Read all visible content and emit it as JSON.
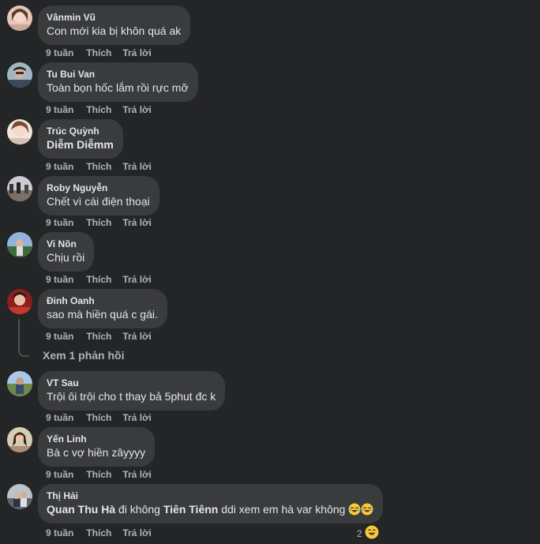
{
  "comments": [
    {
      "author": "Vânmin Vũ",
      "text": "Con mới kia bị khôn quá ak",
      "time": "9 tuần",
      "like": "Thích",
      "reply": "Trả lời"
    },
    {
      "author": "Tu Bui Van",
      "text": "Toàn bọn hốc lắm rồi rực mỡ",
      "time": "9 tuần",
      "like": "Thích",
      "reply": "Trả lời"
    },
    {
      "author": "Trúc Quỳnh",
      "text": "Diễm Diễmm",
      "time": "9 tuần",
      "like": "Thích",
      "reply": "Trả lời"
    },
    {
      "author": "Roby Nguyễn",
      "text": "Chết vì cái điện thoại",
      "time": "9 tuần",
      "like": "Thích",
      "reply": "Trả lời"
    },
    {
      "author": "Vi Nõn",
      "text": "Chịu rồi",
      "time": "9 tuần",
      "like": "Thích",
      "reply": "Trả lời"
    },
    {
      "author": "Đinh Oanh",
      "text": "sao mà hiền quá c gái.",
      "time": "9 tuần",
      "like": "Thích",
      "reply": "Trả lời",
      "view_replies": "Xem 1 phản hồi"
    },
    {
      "author": "VT Sau",
      "text": "Trội ôi trội cho t thay bả 5phut đc k",
      "time": "9 tuần",
      "like": "Thích",
      "reply": "Trả lời"
    },
    {
      "author": "Yến Linh",
      "text": "Bà c vợ hiền zâyyyy",
      "time": "9 tuần",
      "like": "Thích",
      "reply": "Trả lời"
    },
    {
      "author": "Thị Hải",
      "mention1": "Quan Thu Hà",
      "text_mid": "đi không",
      "mention2": "Tiên Tiênn",
      "text_end": "ddi xem em hà var không",
      "time": "9 tuần",
      "like": "Thích",
      "reply": "Trả lời",
      "reaction_count": "2"
    }
  ],
  "icons": {
    "avatar": "avatar-photo",
    "laugh": "laughing-emoji",
    "haha_reaction": "haha-reaction-icon"
  },
  "colors": {
    "background": "#242526",
    "bubble": "#3a3b3c",
    "text": "#e4e6eb",
    "secondary": "#b0b3b8"
  }
}
